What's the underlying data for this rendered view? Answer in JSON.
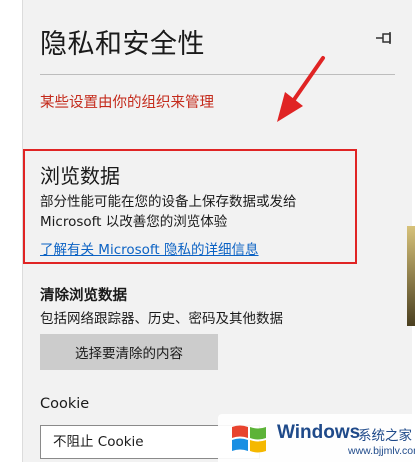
{
  "panel": {
    "title": "隐私和安全性",
    "managed_notice": "某些设置由你的组织来管理"
  },
  "browsing_data": {
    "title": "浏览数据",
    "description": "部分性能可能在您的设备上保存数据或发给 Microsoft 以改善您的浏览体验",
    "link": "了解有关 Microsoft 隐私的详细信息"
  },
  "clear_browsing": {
    "title": "清除浏览数据",
    "description": "包括网络跟踪器、历史、密码及其他数据",
    "button_label": "选择要清除的内容"
  },
  "cookie": {
    "label": "Cookie",
    "selected": "不阻止 Cookie"
  },
  "watermark": {
    "brand": "Windows",
    "cn": "系统之家",
    "url": "www.bjjmlv.com"
  },
  "colors": {
    "notice_red": "#c42b1c",
    "highlight_red": "#e02424",
    "link_blue": "#0b62c4",
    "button_gray": "#cccccc"
  },
  "icons": {
    "pin": "pin-icon",
    "arrow": "red-arrow-annotation",
    "logo": "windows-logo-icon"
  }
}
